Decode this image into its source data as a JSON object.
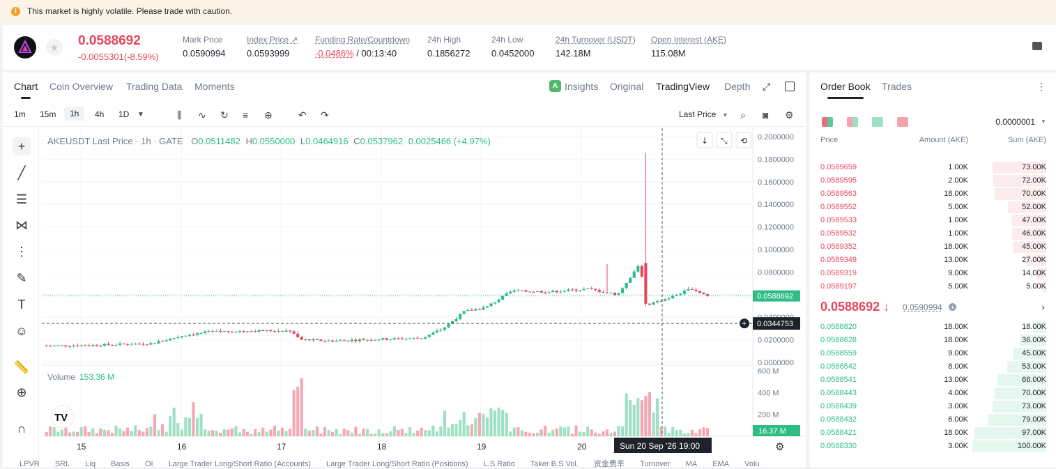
{
  "banner": {
    "text": "This market is highly volatile. Please trade with caution."
  },
  "ticker": {
    "last_price": "0.0588692",
    "change": "-0.0055301(-8.59%)",
    "stats": [
      {
        "label": "Mark Price",
        "value": "0.0590994"
      },
      {
        "label": "Index Price ↗",
        "value": "0.0593999"
      },
      {
        "label": "Funding Rate/Countdown",
        "value_red": "-0.0486%",
        "value": " / 00:13:40"
      },
      {
        "label": "24h High",
        "value": "0.1856272"
      },
      {
        "label": "24h Low",
        "value": "0.0452000"
      },
      {
        "label": "24h Turnover (USDT)",
        "value": "142.18M"
      },
      {
        "label": "Open Interest (AKE)",
        "value": "115.08M"
      }
    ]
  },
  "chart_tabs": [
    "Chart",
    "Coin Overview",
    "Trading Data",
    "Moments"
  ],
  "chart_modes": [
    "Insights",
    "Original",
    "TradingView",
    "Depth"
  ],
  "intervals": [
    "1m",
    "15m",
    "1h",
    "4h",
    "1D"
  ],
  "price_type": "Last Price",
  "legend": {
    "symbol": "AKEUSDT Last Price · 1h · GATE",
    "o_label": "O",
    "o": "0.0511482",
    "h_label": "H",
    "h": "0.0550000",
    "l_label": "L",
    "l": "0.0464916",
    "c_label": "C",
    "c": "0.0537962",
    "chg": "0.0025466 (+4.97%)"
  },
  "volume": {
    "label": "Volume",
    "value": "153.36 M"
  },
  "crosshair": {
    "price": "0.0344753",
    "time": "Sun 20 Sep '26   19:00",
    "last_tag": "0.0588692",
    "vol_tag": "16.37 M"
  },
  "bottom_indicators": [
    "LPVR",
    "SRL",
    "Liq",
    "Basis",
    "OI",
    "Large Trader Long/Short Ratio (Accounts)",
    "Large Trader Long/Short Ratio (Positions)",
    "L.S Ratio",
    "Taker B.S Vol.",
    "资金费率",
    "Turnover",
    "MA",
    "EMA",
    "Volu"
  ],
  "chart_data": {
    "type": "candlestick",
    "y_ticks": [
      "0.2000000",
      "0.1800000",
      "0.1600000",
      "0.1400000",
      "0.1200000",
      "0.1000000",
      "0.0800000",
      "0.0600000",
      "0.0400000",
      "0.0200000",
      "0.0000000"
    ],
    "ylim": [
      0,
      0.2
    ],
    "vol_ticks": [
      "600 M",
      "400 M",
      "200 M"
    ],
    "vol_max": 600,
    "x_ticks": [
      "15",
      "16",
      "17",
      "18",
      "19",
      "20"
    ],
    "spike": {
      "high": 0.1856272,
      "open": 0.088,
      "close": 0.052
    },
    "candles_note": "hourly candles"
  },
  "order_book": {
    "tabs": [
      "Order Book",
      "Trades"
    ],
    "precision": "0.0000001",
    "headers": {
      "price": "Price",
      "amount": "Amount (AKE)",
      "sum": "Sum (AKE)"
    },
    "asks": [
      {
        "price": "0.0589659",
        "amount": "1.00K",
        "sum": "73.00K",
        "pct": 0.73
      },
      {
        "price": "0.0589595",
        "amount": "2.00K",
        "sum": "72.00K",
        "pct": 0.72
      },
      {
        "price": "0.0589563",
        "amount": "18.00K",
        "sum": "70.00K",
        "pct": 0.7
      },
      {
        "price": "0.0589552",
        "amount": "5.00K",
        "sum": "52.00K",
        "pct": 0.52
      },
      {
        "price": "0.0589533",
        "amount": "1.00K",
        "sum": "47.00K",
        "pct": 0.47
      },
      {
        "price": "0.0589532",
        "amount": "1.00K",
        "sum": "46.00K",
        "pct": 0.46
      },
      {
        "price": "0.0589352",
        "amount": "18.00K",
        "sum": "45.00K",
        "pct": 0.45
      },
      {
        "price": "0.0589349",
        "amount": "13.00K",
        "sum": "27.00K",
        "pct": 0.27
      },
      {
        "price": "0.0589319",
        "amount": "9.00K",
        "sum": "14.00K",
        "pct": 0.14
      },
      {
        "price": "0.0589197",
        "amount": "5.00K",
        "sum": "5.00K",
        "pct": 0.05
      }
    ],
    "mid_price": "0.0588692 ↓",
    "mid_mark": "0.0590994",
    "bids": [
      {
        "price": "0.0588820",
        "amount": "18.00K",
        "sum": "18.00K",
        "pct": 0.18
      },
      {
        "price": "0.0588628",
        "amount": "18.00K",
        "sum": "36.00K",
        "pct": 0.36
      },
      {
        "price": "0.0588559",
        "amount": "9.00K",
        "sum": "45.00K",
        "pct": 0.45
      },
      {
        "price": "0.0588542",
        "amount": "8.00K",
        "sum": "53.00K",
        "pct": 0.53
      },
      {
        "price": "0.0588541",
        "amount": "13.00K",
        "sum": "66.00K",
        "pct": 0.66
      },
      {
        "price": "0.0588443",
        "amount": "4.00K",
        "sum": "70.00K",
        "pct": 0.7
      },
      {
        "price": "0.0588439",
        "amount": "3.00K",
        "sum": "73.00K",
        "pct": 0.73
      },
      {
        "price": "0.0588432",
        "amount": "6.00K",
        "sum": "79.00K",
        "pct": 0.79
      },
      {
        "price": "0.0588421",
        "amount": "18.00K",
        "sum": "97.00K",
        "pct": 0.97
      },
      {
        "price": "0.0588330",
        "amount": "3.00K",
        "sum": "100.00K",
        "pct": 1.0
      }
    ]
  },
  "colors": {
    "up": "#2ebd85",
    "down": "#e5485d",
    "text": "#1f2329",
    "muted": "#707a8a"
  }
}
